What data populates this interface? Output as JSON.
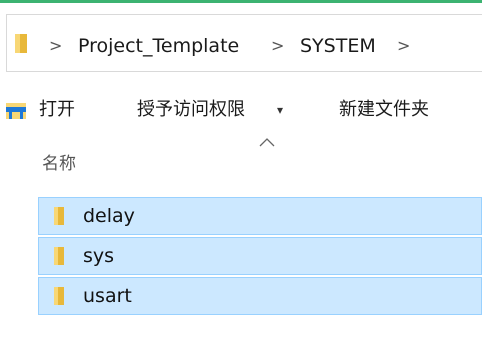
{
  "address": {
    "crumbs": [
      "Project_Template",
      "SYSTEM"
    ],
    "separator": ">"
  },
  "toolbar": {
    "open_label": "打开",
    "grant_access_label": "授予访问权限",
    "grant_access_caret": "▾",
    "new_folder_label": "新建文件夹"
  },
  "list": {
    "column_name_header": "名称",
    "items": [
      {
        "name": "delay",
        "icon": "folder-icon",
        "selected": true
      },
      {
        "name": "sys",
        "icon": "folder-icon",
        "selected": true
      },
      {
        "name": "usart",
        "icon": "folder-icon",
        "selected": true
      }
    ]
  },
  "colors": {
    "selection_bg": "#cce8ff",
    "selection_border": "#99d1ff",
    "folder_yellow": "#f8d775",
    "accent_green": "#3cb371",
    "open_icon_blue": "#1e78d7"
  }
}
